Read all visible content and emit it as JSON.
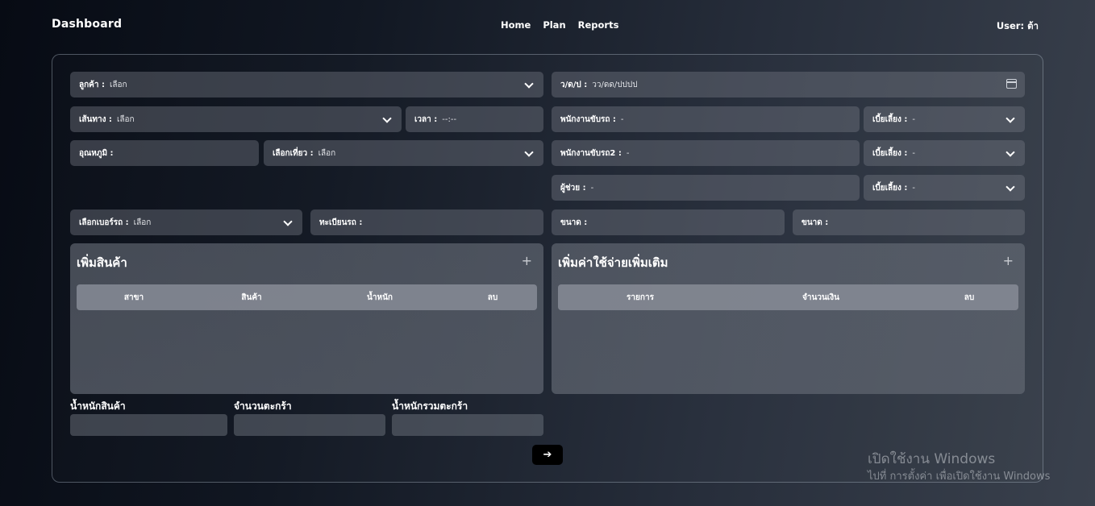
{
  "nav": {
    "brand": "Dashboard",
    "links": [
      "Home",
      "Plan",
      "Reports"
    ],
    "user": "User: ต้า"
  },
  "form": {
    "customer": {
      "label": "ลูกค้า :",
      "value": "เลือก"
    },
    "date": {
      "label": "ว/ด/ป :",
      "value": "วว/ดด/ปปปป"
    },
    "route": {
      "label": "เส้นทาง :",
      "value": "เลือก"
    },
    "time": {
      "label": "เวลา :",
      "value": "--:--"
    },
    "driver1": {
      "label": "พนักงานขับรถ :",
      "value": "-"
    },
    "allowance1": {
      "label": "เบี้ยเลี้ยง :",
      "value": "-"
    },
    "temperature": {
      "label": "อุณหภูมิ :",
      "value": ""
    },
    "trip": {
      "label": "เลือกเที่ยว :",
      "value": "เลือก"
    },
    "driver2": {
      "label": "พนักงานขับรถ2 :",
      "value": "-"
    },
    "allowance2": {
      "label": "เบี้ยเลี้ยง :",
      "value": "-"
    },
    "assistant": {
      "label": "ผู้ช่วย :",
      "value": "-"
    },
    "allowance3": {
      "label": "เบี้ยเลี้ยง :",
      "value": "-"
    },
    "vehicle_number": {
      "label": "เลือกเบอร์รถ :",
      "value": "เลือก"
    },
    "plate": {
      "label": "ทะเบียนรถ :",
      "value": ""
    },
    "size1": {
      "label": "ขนาด :",
      "value": ""
    },
    "size2": {
      "label": "ขนาด :",
      "value": ""
    }
  },
  "products_card": {
    "title": "เพิ่มสินค้า",
    "add_icon": "+",
    "columns": [
      "สาขา",
      "สินค้า",
      "น้ำหนัก",
      "ลบ"
    ],
    "rows": []
  },
  "expenses_card": {
    "title": "เพิ่มค่าใช้จ่ายเพิ่มเติม",
    "add_icon": "+",
    "columns": [
      "รายการ",
      "จำนวนเงิน",
      "ลบ"
    ],
    "rows": []
  },
  "totals": {
    "product_weight_label": "น้ำหนักสินค้า",
    "basket_count_label": "จำนวนตะกร้า",
    "basket_weight_label": "น้ำหนักรวมตะกร้า"
  },
  "next_button": "➔",
  "watermark": {
    "line1": "เปิดใช้งาน Windows",
    "line2": "ไปที่ การตั้งค่า เพื่อเปิดใช้งาน Windows"
  },
  "colors": {
    "background": "#111722",
    "field": "#4a505a",
    "button": "#000000"
  }
}
